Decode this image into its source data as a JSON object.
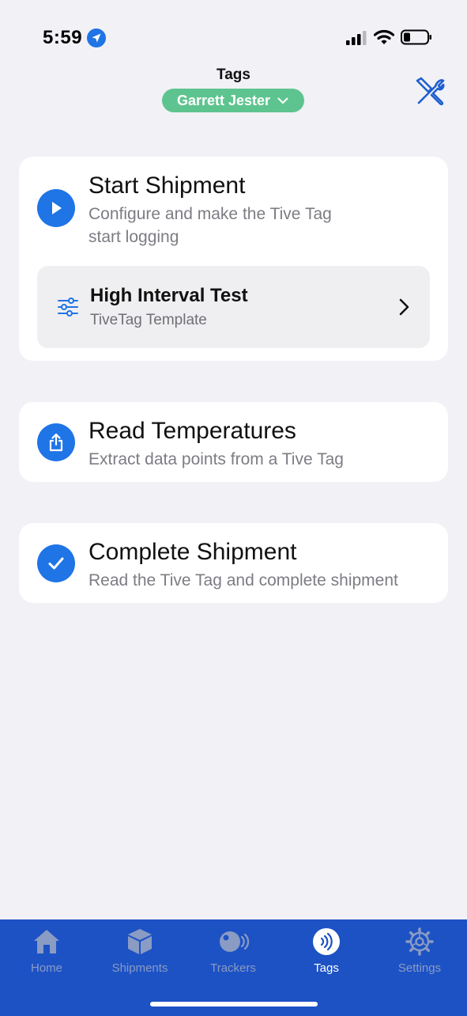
{
  "status_bar": {
    "time": "5:59",
    "icons": [
      "location-arrow-icon",
      "signal-icon",
      "wifi-icon",
      "battery-icon"
    ]
  },
  "header": {
    "title": "Tags",
    "user_name": "Garrett Jester",
    "tools_icon": "tools-icon"
  },
  "cards": {
    "start": {
      "title": "Start Shipment",
      "description_line1": "Configure and make the Tive Tag",
      "description_line2": "start logging",
      "icon": "play-icon",
      "template": {
        "title": "High Interval Test",
        "subtitle": "TiveTag Template",
        "icon": "sliders-icon"
      }
    },
    "read": {
      "title": "Read Temperatures",
      "description": "Extract data points from a Tive Tag",
      "icon": "share-upload-icon"
    },
    "complete": {
      "title": "Complete Shipment",
      "description": "Read the Tive Tag and complete shipment",
      "icon": "checkmark-icon"
    }
  },
  "tab_bar": {
    "tabs": [
      {
        "label": "Home",
        "icon": "home-icon",
        "active": false
      },
      {
        "label": "Shipments",
        "icon": "package-icon",
        "active": false
      },
      {
        "label": "Trackers",
        "icon": "tracker-icon",
        "active": false
      },
      {
        "label": "Tags",
        "icon": "nfc-tag-icon",
        "active": true
      },
      {
        "label": "Settings",
        "icon": "gear-icon",
        "active": false
      }
    ]
  },
  "colors": {
    "accent_blue": "#1f74e6",
    "pill_green": "#5ec48f",
    "tab_bar_blue": "#1d52c4",
    "background": "#f1f1f6"
  }
}
